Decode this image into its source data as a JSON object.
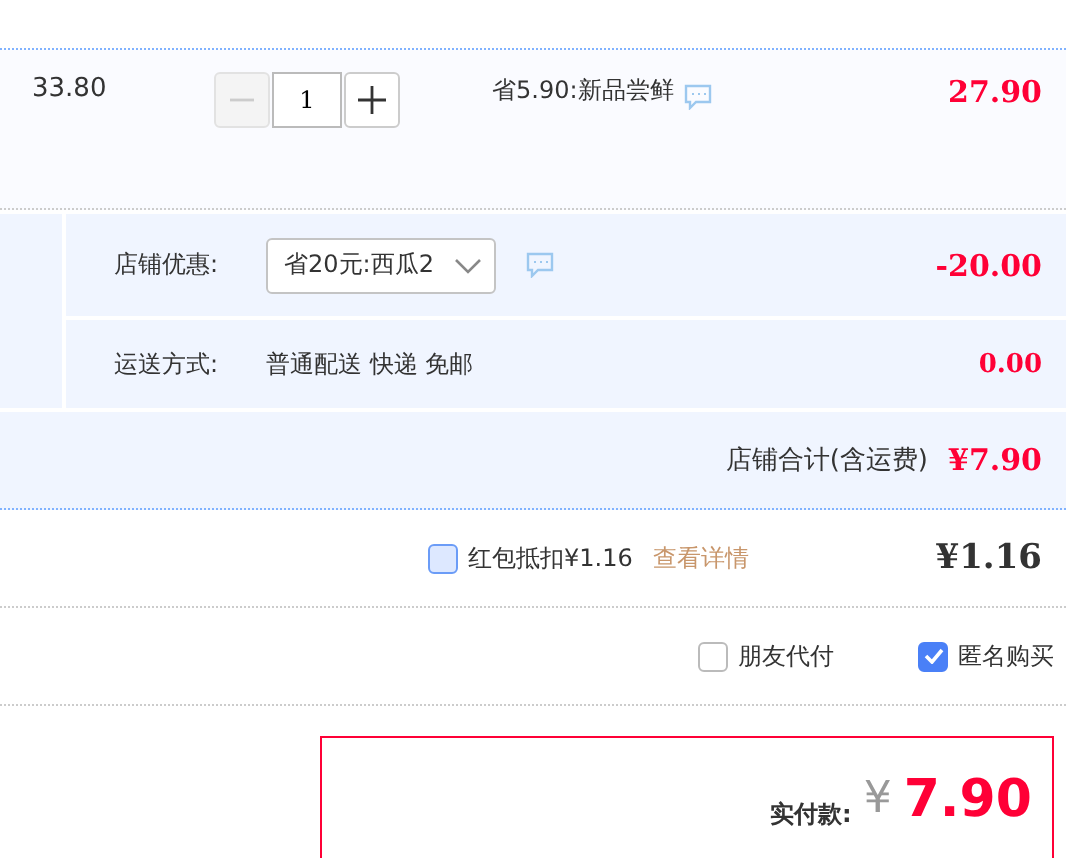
{
  "item": {
    "unit_price": "33.80",
    "quantity": "1",
    "decrease_disabled": true,
    "promo": "省5.90:新品尝鲜",
    "subtotal": "27.90"
  },
  "shop_discount": {
    "label": "店铺优惠:",
    "value": "省20元:西瓜2",
    "amount": "-20.00"
  },
  "shipping": {
    "label": "运送方式:",
    "value": "普通配送 快递 免邮",
    "amount": "0.00"
  },
  "shop_total": {
    "label": "店铺合计(含运费)",
    "amount": "¥7.90"
  },
  "red_packet": {
    "label": "红包抵扣¥1.16",
    "checked": false,
    "link": "查看详情",
    "amount": "¥1.16"
  },
  "options": [
    {
      "label": "朋友代付",
      "checked": false
    },
    {
      "label": "匿名购买",
      "checked": true
    }
  ],
  "payment": {
    "label": "实付款:",
    "currency": "¥",
    "amount": "7.90"
  }
}
